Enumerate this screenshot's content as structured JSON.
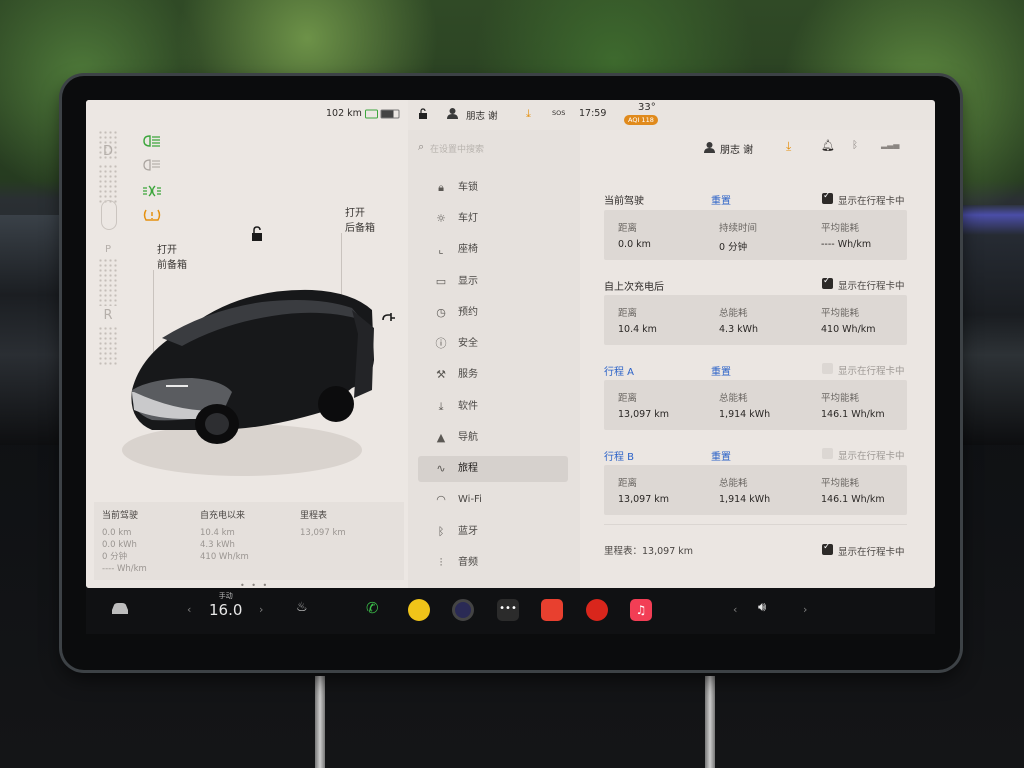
{
  "status_bar": {
    "range": "102 km",
    "user": "朋志 谢",
    "sos": "SOS",
    "time": "17:59",
    "temperature": "33°",
    "aqi": "AQI 118"
  },
  "car_panel": {
    "gears": [
      "D",
      "P",
      "R"
    ],
    "front_trunk_action": "打开",
    "front_trunk_label": "前备箱",
    "rear_trunk_action": "打开",
    "rear_trunk_label": "后备箱",
    "stats": {
      "current_drive": {
        "title": "当前驾驶",
        "v1": "0.0 km",
        "v2": "0.0 kWh",
        "v3": "0 分钟",
        "v4": "---- Wh/km"
      },
      "since_charge": {
        "title": "自充电以来",
        "v1": "10.4 km",
        "v2": "4.3 kWh",
        "v3": "410 Wh/km"
      },
      "odometer": {
        "title": "里程表",
        "v1": "13,097 km"
      }
    },
    "page_dots": "• • •"
  },
  "menu": {
    "search_placeholder": "在设置中搜索",
    "items": [
      {
        "label": "车锁",
        "icon": "lock-icon"
      },
      {
        "label": "车灯",
        "icon": "light-icon"
      },
      {
        "label": "座椅",
        "icon": "seat-icon"
      },
      {
        "label": "显示",
        "icon": "display-icon"
      },
      {
        "label": "预约",
        "icon": "clock-icon"
      },
      {
        "label": "安全",
        "icon": "safety-icon"
      },
      {
        "label": "服务",
        "icon": "wrench-icon"
      },
      {
        "label": "软件",
        "icon": "download-icon"
      },
      {
        "label": "导航",
        "icon": "navigation-icon"
      },
      {
        "label": "旅程",
        "icon": "trip-icon"
      },
      {
        "label": "Wi-Fi",
        "icon": "wifi-icon"
      },
      {
        "label": "蓝牙",
        "icon": "bluetooth-icon"
      },
      {
        "label": "音频",
        "icon": "audio-icon"
      }
    ]
  },
  "content": {
    "user": "朋志 谢",
    "show_on_trip_card": "显示在行程卡中",
    "reset": "重置",
    "sections": [
      {
        "title": "当前驾驶",
        "reset": true,
        "checked": true,
        "cells": [
          {
            "key": "距离",
            "value": "0.0 km"
          },
          {
            "key": "持续时间",
            "value": "0 分钟"
          },
          {
            "key": "平均能耗",
            "value": "---- Wh/km"
          }
        ]
      },
      {
        "title": "自上次充电后",
        "reset": false,
        "checked": true,
        "cells": [
          {
            "key": "距离",
            "value": "10.4 km"
          },
          {
            "key": "总能耗",
            "value": "4.3 kWh"
          },
          {
            "key": "平均能耗",
            "value": "410 Wh/km"
          }
        ]
      },
      {
        "title": "行程 A",
        "reset": true,
        "checked": false,
        "cells": [
          {
            "key": "距离",
            "value": "13,097 km"
          },
          {
            "key": "总能耗",
            "value": "1,914 kWh"
          },
          {
            "key": "平均能耗",
            "value": "146.1 Wh/km"
          }
        ]
      },
      {
        "title": "行程 B",
        "reset": true,
        "checked": false,
        "cells": [
          {
            "key": "距离",
            "value": "13,097 km"
          },
          {
            "key": "总能耗",
            "value": "1,914 kWh"
          },
          {
            "key": "平均能耗",
            "value": "146.1 Wh/km"
          }
        ]
      }
    ],
    "odometer": "里程表：13,097 km",
    "odometer_checked": true
  },
  "dock": {
    "climate_mode": "手动",
    "temperature": "16.0"
  },
  "colors": {
    "accent_blue": "#2b62c8",
    "indicator_green": "#3ca63c",
    "indicator_orange": "#e5900f"
  }
}
